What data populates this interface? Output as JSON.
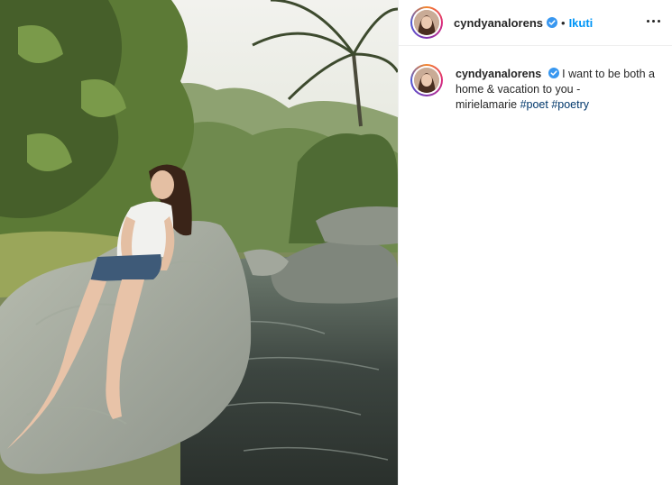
{
  "post": {
    "image": {
      "scene": "woman-sitting-on-river-rock-photo"
    },
    "header": {
      "username": "cyndyanalorens",
      "separator": "•",
      "follow_label": "Ikuti",
      "more_icon": "more-horizontal-icon",
      "verified_icon": "verified-badge-icon"
    },
    "caption": {
      "username": "cyndyanalorens",
      "text_line1": "I want to be both a",
      "text_line2": "home & vacation to you -",
      "text_line3": "mirielamarie",
      "hashtags": [
        "#poet",
        "#poetry"
      ]
    }
  },
  "colors": {
    "accent": "#0095f6",
    "hashtag": "#00376b",
    "verified": "#3897f0",
    "border": "#efefef"
  }
}
